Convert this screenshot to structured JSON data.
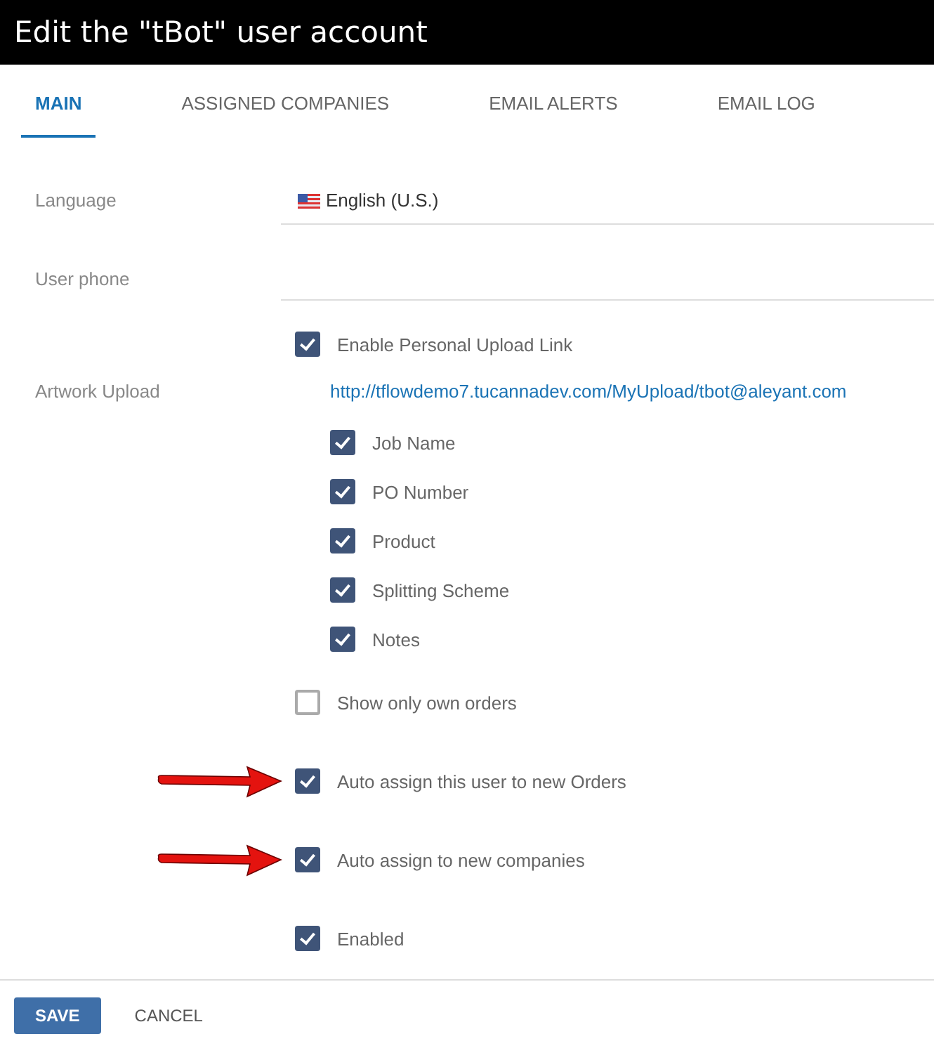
{
  "window": {
    "title": "Edit the \"tBot\" user account"
  },
  "tabs": [
    {
      "label": "MAIN",
      "selected": true
    },
    {
      "label": "ASSIGNED COMPANIES",
      "selected": false
    },
    {
      "label": "EMAIL ALERTS",
      "selected": false
    },
    {
      "label": "EMAIL LOG",
      "selected": false
    }
  ],
  "language": {
    "label": "Language",
    "value": "English (U.S.)"
  },
  "user_phone": {
    "label": "User phone"
  },
  "artwork_upload": {
    "label": "Artwork Upload",
    "enable": {
      "label": "Enable Personal Upload Link",
      "checked": true
    },
    "link": "http://tflowdemo7.tucannadev.com/MyUpload/tbot@aleyant.com",
    "options": [
      {
        "label": "Job Name",
        "checked": true
      },
      {
        "label": "PO Number",
        "checked": true
      },
      {
        "label": "Product",
        "checked": true
      },
      {
        "label": "Splitting Scheme",
        "checked": true
      },
      {
        "label": "Notes",
        "checked": true
      }
    ]
  },
  "options": [
    {
      "label": "Show only own orders",
      "checked": false,
      "highlighted": false
    },
    {
      "label": "Auto assign this user to new Orders",
      "checked": true,
      "highlighted": true
    },
    {
      "label": "Auto assign to new companies",
      "checked": true,
      "highlighted": true
    },
    {
      "label": "Enabled",
      "checked": true,
      "highlighted": false
    }
  ],
  "buttons": [
    {
      "label": "SAVE",
      "kind": "primary"
    },
    {
      "label": "CANCEL",
      "kind": "flat"
    }
  ]
}
